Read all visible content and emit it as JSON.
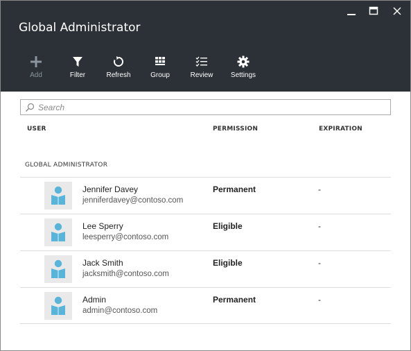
{
  "blade": {
    "title": "Global Administrator"
  },
  "window_controls": [
    {
      "name": "minimize",
      "icon": "minimize-icon"
    },
    {
      "name": "maximize",
      "icon": "maximize-icon"
    },
    {
      "name": "close",
      "icon": "close-icon"
    }
  ],
  "toolbar": {
    "add_label": "Add",
    "filter_label": "Filter",
    "refresh_label": "Refresh",
    "group_label": "Group",
    "review_label": "Review",
    "settings_label": "Settings"
  },
  "search": {
    "placeholder": "Search",
    "value": ""
  },
  "columns": {
    "user": "USER",
    "permission": "PERMISSION",
    "expiration": "EXPIRATION"
  },
  "group": {
    "label": "GLOBAL ADMINISTRATOR"
  },
  "users": [
    {
      "name": "Jennifer Davey",
      "email": "jenniferdavey@contoso.com",
      "permission": "Permanent",
      "expiration": "-"
    },
    {
      "name": "Lee Sperry",
      "email": "leesperry@contoso.com",
      "permission": "Eligible",
      "expiration": "-"
    },
    {
      "name": "Jack Smith",
      "email": "jacksmith@contoso.com",
      "permission": "Eligible",
      "expiration": "-"
    },
    {
      "name": "Admin",
      "email": "admin@contoso.com",
      "permission": "Permanent",
      "expiration": "-"
    }
  ],
  "colors": {
    "header_bg": "#2b3137",
    "avatar_accent": "#59b4d9",
    "disabled_text": "#8c959d"
  }
}
